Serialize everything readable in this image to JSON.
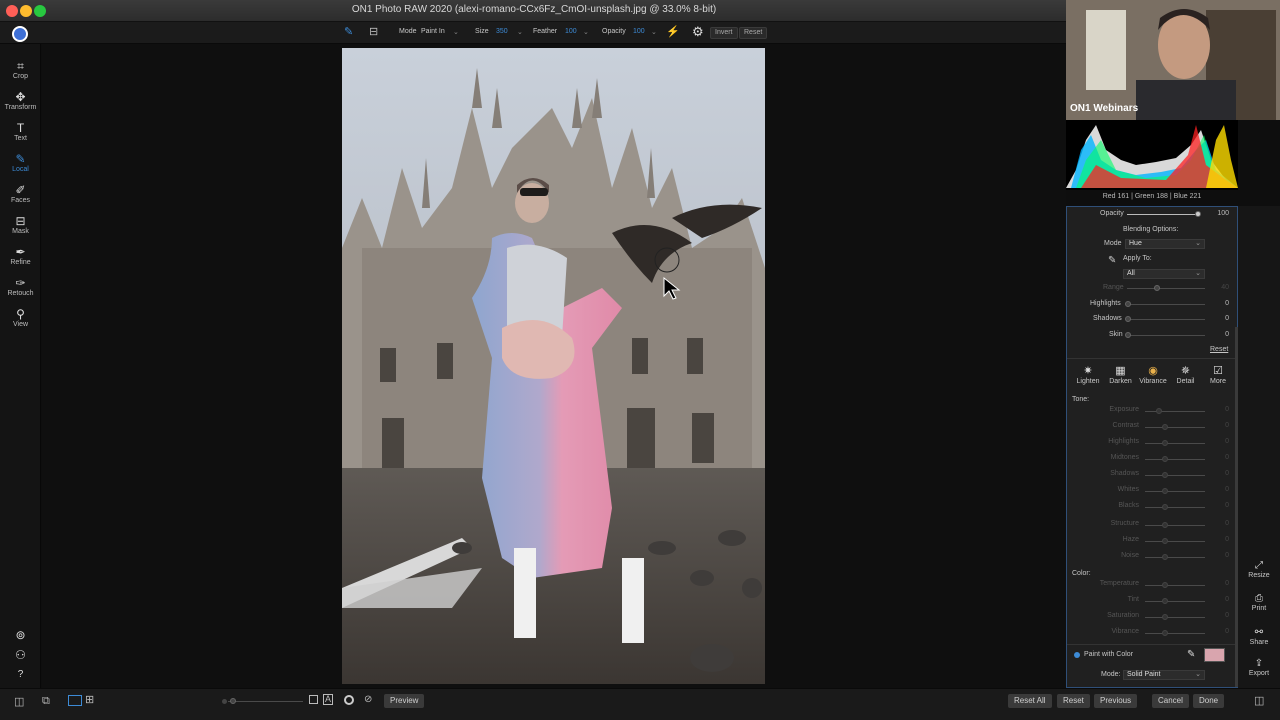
{
  "window": {
    "title": "ON1 Photo RAW 2020 (alexi-romano-CCx6Fz_CmOI-unsplash.jpg @ 33.0% 8-bit)"
  },
  "toolbar": {
    "mode_label": "Mode",
    "mode_value": "Paint In",
    "size_label": "Size",
    "size_value": "350",
    "feather_label": "Feather",
    "feather_value": "100",
    "opacity_label": "Opacity",
    "opacity_value": "100",
    "invert_label": "Invert",
    "reset_label": "Reset"
  },
  "left_tools": [
    {
      "label": "Crop",
      "icon": "crop-icon",
      "glyph": "⌗"
    },
    {
      "label": "Transform",
      "icon": "move-icon",
      "glyph": "✥"
    },
    {
      "label": "Text",
      "icon": "text-icon",
      "glyph": "T"
    },
    {
      "label": "Local",
      "icon": "brush-icon",
      "glyph": "✎",
      "active": true
    },
    {
      "label": "Faces",
      "icon": "faces-icon",
      "glyph": "✐"
    },
    {
      "label": "Mask",
      "icon": "mask-icon",
      "glyph": "⊟"
    },
    {
      "label": "Refine",
      "icon": "refine-icon",
      "glyph": "✒"
    },
    {
      "label": "Retouch",
      "icon": "retouch-icon",
      "glyph": "✑"
    },
    {
      "label": "View",
      "icon": "zoom-icon",
      "glyph": "⚲"
    }
  ],
  "webcam": {
    "caption": "ON1 Webinars"
  },
  "histogram": {
    "readout": "Red 161 | Green 188 | Blue 221"
  },
  "panel": {
    "opacity_label": "Opacity",
    "opacity_value": "100",
    "blending_options": "Blending Options:",
    "mode_label": "Mode",
    "mode_value": "Hue",
    "apply_to_label": "Apply To:",
    "apply_to_value": "All",
    "range_label": "Range",
    "range_value": "40",
    "highlights_label": "Highlights",
    "highlights_value": "0",
    "shadows_label": "Shadows",
    "shadows_value": "0",
    "skin_label": "Skin",
    "skin_value": "0",
    "reset_label": "Reset",
    "presets": [
      {
        "label": "Lighten",
        "icon": "lighten-icon",
        "glyph": "✷"
      },
      {
        "label": "Darken",
        "icon": "darken-icon",
        "glyph": "▦"
      },
      {
        "label": "Vibrance",
        "icon": "vibrance-icon",
        "glyph": "◉"
      },
      {
        "label": "Detail",
        "icon": "detail-icon",
        "glyph": "✵"
      },
      {
        "label": "More",
        "icon": "more-icon",
        "glyph": "☑"
      }
    ],
    "tone_label": "Tone:",
    "tone_sliders": [
      {
        "label": "Exposure",
        "value": "0"
      },
      {
        "label": "Contrast",
        "value": "0"
      },
      {
        "label": "Highlights",
        "value": "0"
      },
      {
        "label": "Midtones",
        "value": "0"
      },
      {
        "label": "Shadows",
        "value": "0"
      },
      {
        "label": "Whites",
        "value": "0"
      },
      {
        "label": "Blacks",
        "value": "0"
      },
      {
        "label": "Structure",
        "value": "0"
      },
      {
        "label": "Haze",
        "value": "0"
      },
      {
        "label": "Noise",
        "value": "0"
      }
    ],
    "color_label": "Color:",
    "color_sliders": [
      {
        "label": "Temperature",
        "value": "0"
      },
      {
        "label": "Tint",
        "value": "0"
      },
      {
        "label": "Saturation",
        "value": "0"
      },
      {
        "label": "Vibrance",
        "value": "0"
      }
    ],
    "paint_with_color_label": "Paint with Color",
    "paint_color": "#d9a5ae",
    "paint_mode_label": "Mode:",
    "paint_mode_value": "Solid Paint"
  },
  "right_strip": [
    {
      "label": "Resize",
      "icon": "resize-icon",
      "glyph": "⤢"
    },
    {
      "label": "Print",
      "icon": "print-icon",
      "glyph": "⎙"
    },
    {
      "label": "Share",
      "icon": "share-icon",
      "glyph": "⚯"
    },
    {
      "label": "Export",
      "icon": "export-icon",
      "glyph": "⇪"
    }
  ],
  "bottom": {
    "preview_label": "Preview",
    "reset_all_label": "Reset All",
    "reset_label": "Reset",
    "previous_label": "Previous",
    "cancel_label": "Cancel",
    "done_label": "Done"
  },
  "colors": {
    "accent": "#3d8bd6"
  }
}
